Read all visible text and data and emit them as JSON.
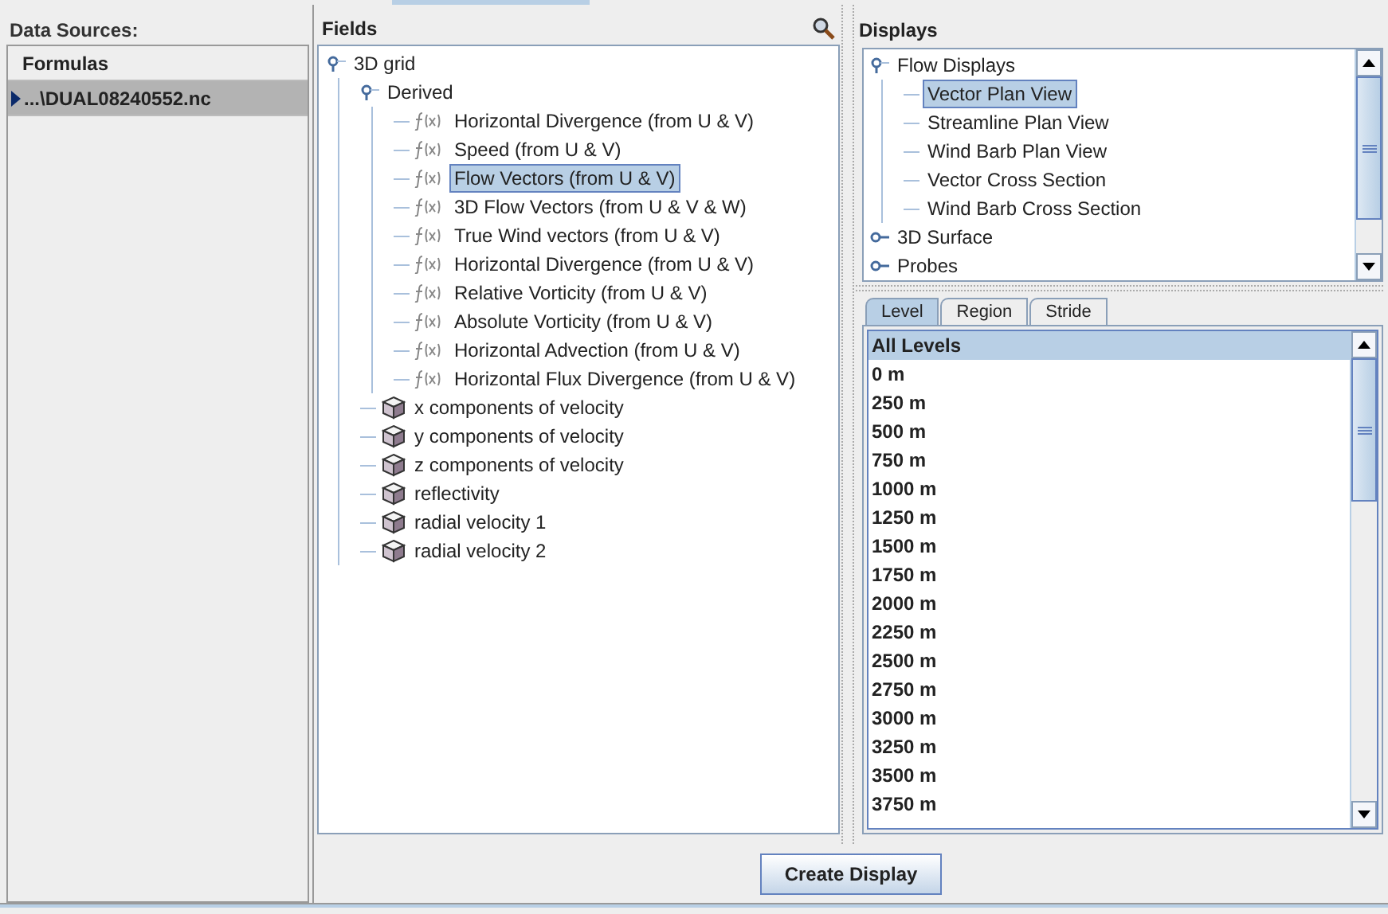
{
  "data_sources": {
    "title": "Data Sources:",
    "items": [
      {
        "label": "Formulas",
        "selected": false
      },
      {
        "label": "...\\DUAL08240552.nc",
        "selected": true
      }
    ]
  },
  "fields": {
    "title": "Fields",
    "tree": [
      {
        "label": "3D grid",
        "kind": "group",
        "expanded": true,
        "children": [
          {
            "label": "Derived",
            "kind": "group",
            "expanded": true,
            "children": [
              {
                "label": "Horizontal Divergence (from U & V)",
                "kind": "formula",
                "selected": false
              },
              {
                "label": "Speed (from U & V)",
                "kind": "formula",
                "selected": false
              },
              {
                "label": "Flow Vectors (from U & V)",
                "kind": "formula",
                "selected": true
              },
              {
                "label": "3D Flow Vectors (from U & V & W)",
                "kind": "formula",
                "selected": false
              },
              {
                "label": "True Wind vectors (from U & V)",
                "kind": "formula",
                "selected": false
              },
              {
                "label": "Horizontal Divergence (from U & V)",
                "kind": "formula",
                "selected": false
              },
              {
                "label": "Relative Vorticity (from U & V)",
                "kind": "formula",
                "selected": false
              },
              {
                "label": "Absolute Vorticity (from U & V)",
                "kind": "formula",
                "selected": false
              },
              {
                "label": "Horizontal Advection (from U & V)",
                "kind": "formula",
                "selected": false
              },
              {
                "label": "Horizontal Flux Divergence (from U & V)",
                "kind": "formula",
                "selected": false
              }
            ]
          },
          {
            "label": "x components of velocity",
            "kind": "grid",
            "selected": false
          },
          {
            "label": "y components of velocity",
            "kind": "grid",
            "selected": false
          },
          {
            "label": "z components of velocity",
            "kind": "grid",
            "selected": false
          },
          {
            "label": "reflectivity",
            "kind": "grid",
            "selected": false
          },
          {
            "label": "radial velocity 1",
            "kind": "grid",
            "selected": false
          },
          {
            "label": "radial velocity 2",
            "kind": "grid",
            "selected": false
          }
        ]
      }
    ]
  },
  "displays": {
    "title": "Displays",
    "tree": [
      {
        "label": "Flow Displays",
        "kind": "group",
        "expanded": true,
        "children": [
          {
            "label": "Vector Plan View",
            "selected": true
          },
          {
            "label": "Streamline Plan View",
            "selected": false
          },
          {
            "label": "Wind Barb Plan View",
            "selected": false
          },
          {
            "label": "Vector Cross Section",
            "selected": false
          },
          {
            "label": "Wind Barb Cross Section",
            "selected": false
          }
        ]
      },
      {
        "label": "3D Surface",
        "kind": "group",
        "expanded": false
      },
      {
        "label": "Probes",
        "kind": "group",
        "expanded": false
      }
    ]
  },
  "tabs": [
    {
      "label": "Level",
      "selected": true
    },
    {
      "label": "Region",
      "selected": false
    },
    {
      "label": "Stride",
      "selected": false
    }
  ],
  "levels": [
    {
      "label": "All Levels",
      "selected": true
    },
    {
      "label": "0 m",
      "selected": false
    },
    {
      "label": "250 m",
      "selected": false
    },
    {
      "label": "500 m",
      "selected": false
    },
    {
      "label": "750 m",
      "selected": false
    },
    {
      "label": "1000 m",
      "selected": false
    },
    {
      "label": "1250 m",
      "selected": false
    },
    {
      "label": "1500 m",
      "selected": false
    },
    {
      "label": "1750 m",
      "selected": false
    },
    {
      "label": "2000 m",
      "selected": false
    },
    {
      "label": "2250 m",
      "selected": false
    },
    {
      "label": "2500 m",
      "selected": false
    },
    {
      "label": "2750 m",
      "selected": false
    },
    {
      "label": "3000 m",
      "selected": false
    },
    {
      "label": "3250 m",
      "selected": false
    },
    {
      "label": "3500 m",
      "selected": false
    },
    {
      "label": "3750 m",
      "selected": false
    }
  ],
  "button": "Create Display"
}
